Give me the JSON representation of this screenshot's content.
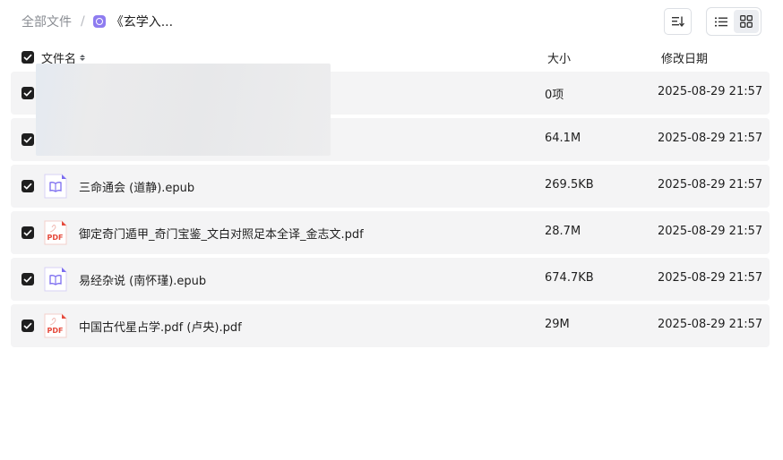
{
  "breadcrumb": {
    "root": "全部文件",
    "separator": "/",
    "current": "《玄学入..."
  },
  "toolbar": {
    "sort_icon": "sort-icon",
    "list_view_icon": "list-view-icon",
    "grid_view_icon": "grid-view-icon",
    "active_view": "list"
  },
  "table": {
    "headers": {
      "name": "文件名",
      "size": "大小",
      "modified": "修改日期"
    },
    "rows": [
      {
        "name": "",
        "size": "0项",
        "date": "2025-08-29 21:57",
        "type": "folder",
        "checked": true
      },
      {
        "name": "",
        "size": "64.1M",
        "date": "2025-08-29 21:57",
        "type": "unknown",
        "checked": true
      },
      {
        "name": "三命通会 (道静).epub",
        "size": "269.5KB",
        "date": "2025-08-29 21:57",
        "type": "epub",
        "checked": true
      },
      {
        "name": "御定奇门遁甲_奇门宝鉴_文白对照足本全译_金志文.pdf",
        "size": "28.7M",
        "date": "2025-08-29 21:57",
        "type": "pdf",
        "checked": true
      },
      {
        "name": "易经杂说 (南怀瑾).epub",
        "size": "674.7KB",
        "date": "2025-08-29 21:57",
        "type": "epub",
        "checked": true
      },
      {
        "name": "中国古代星占学.pdf (卢央).pdf",
        "size": "29M",
        "date": "2025-08-29 21:57",
        "type": "pdf",
        "checked": true
      }
    ]
  },
  "icon_labels": {
    "pdf": "PDF"
  },
  "colors": {
    "accent": "#8e7cf0",
    "pdf_red": "#e5483a",
    "row_bg": "#f4f4f5",
    "checkbox": "#1f1f1f"
  }
}
